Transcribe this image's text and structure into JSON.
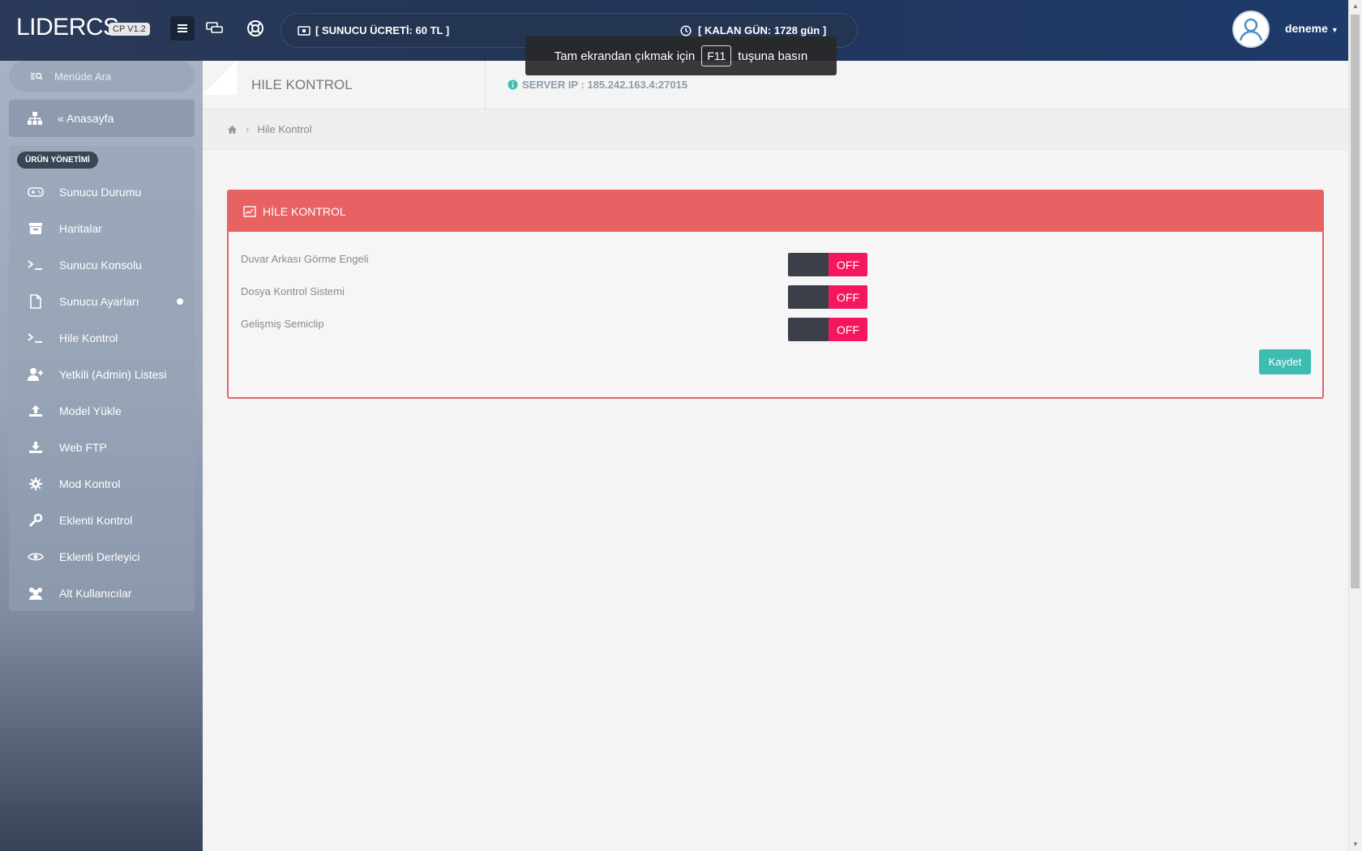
{
  "header": {
    "logo": "LIDERCS",
    "logo_badge": "CP V1.2",
    "server_fee": "[ SUNUCU ÜCRETİ: 60 TL ]",
    "days_left": "[ KALAN GÜN: 1728 gün ]",
    "user": "deneme"
  },
  "toast": {
    "before": "Tam ekrandan çıkmak için",
    "key": "F11",
    "after": "tuşuna basın"
  },
  "sidebar": {
    "search_placeholder": "Menüde Ara",
    "home": "« Anasayfa",
    "section": "ÜRÜN YÖNETİMİ",
    "items": [
      {
        "label": "Sunucu Durumu",
        "icon": "gamepad-icon"
      },
      {
        "label": "Haritalar",
        "icon": "archive-icon"
      },
      {
        "label": "Sunucu Konsolu",
        "icon": "terminal-icon"
      },
      {
        "label": "Sunucu Ayarları",
        "icon": "file-icon"
      },
      {
        "label": "Hile Kontrol",
        "icon": "terminal-icon"
      },
      {
        "label": "Yetkili (Admin) Listesi",
        "icon": "user-plus-icon"
      },
      {
        "label": "Model Yükle",
        "icon": "upload-icon"
      },
      {
        "label": "Web FTP",
        "icon": "download-icon"
      },
      {
        "label": "Mod Kontrol",
        "icon": "gear-icon"
      },
      {
        "label": "Eklenti Kontrol",
        "icon": "wrench-icon"
      },
      {
        "label": "Eklenti Derleyici",
        "icon": "eye-icon"
      },
      {
        "label": "Alt Kullanıcılar",
        "icon": "users-icon"
      }
    ]
  },
  "page": {
    "title": "HILE KONTROL",
    "server_ip": "SERVER IP : 185.242.163.4:27015",
    "breadcrumb": "Hile Kontrol"
  },
  "panel": {
    "title": "HİLE KONTROL",
    "rows": [
      {
        "label": "Duvar Arkası Görme Engeli",
        "state": "OFF"
      },
      {
        "label": "Dosya Kontrol Sistemi",
        "state": "OFF"
      },
      {
        "label": "Gelişmiş Semiclip",
        "state": "OFF"
      }
    ],
    "save": "Kaydet"
  },
  "colors": {
    "accent": "#e86163",
    "toggle_off": "#f4175d",
    "save": "#3dbdb2"
  }
}
